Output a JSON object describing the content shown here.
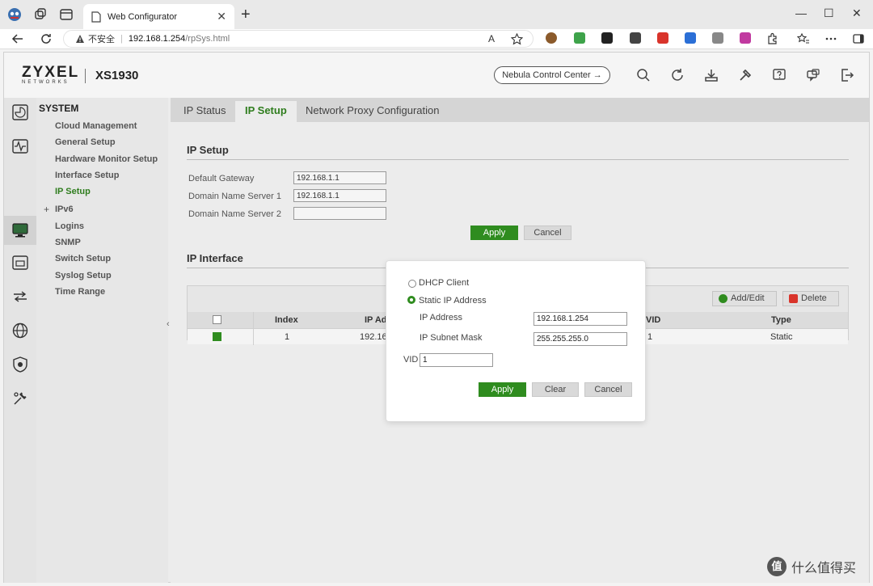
{
  "browser": {
    "tab_title": "Web Configurator",
    "tab_close": "✕",
    "new_tab": "+",
    "url_warning": "不安全",
    "url_host": "192.168.1.254",
    "url_path": "/rpSys.html",
    "read_aloud": "A",
    "win_min": "—",
    "win_max": "☐",
    "win_close": "✕"
  },
  "app": {
    "brand": "ZYXEL",
    "brand_sub": "NETWORKS",
    "model": "XS1930",
    "nebula_button": "Nebula Control Center →"
  },
  "sidemenu": {
    "heading": "SYSTEM",
    "items": [
      {
        "label": "Cloud Management"
      },
      {
        "label": "General Setup"
      },
      {
        "label": "Hardware Monitor Setup"
      },
      {
        "label": "Interface Setup"
      },
      {
        "label": "IP Setup"
      },
      {
        "label": "IPv6"
      },
      {
        "label": "Logins"
      },
      {
        "label": "SNMP"
      },
      {
        "label": "Switch Setup"
      },
      {
        "label": "Syslog Setup"
      },
      {
        "label": "Time Range"
      }
    ],
    "expand_symbol": "+",
    "collapse_symbol": "‹"
  },
  "tabs": [
    {
      "label": "IP Status"
    },
    {
      "label": "IP Setup"
    },
    {
      "label": "Network Proxy Configuration"
    }
  ],
  "ip_setup": {
    "title": "IP Setup",
    "default_gateway_label": "Default Gateway",
    "default_gateway_value": "192.168.1.1",
    "dns1_label": "Domain Name Server 1",
    "dns1_value": "192.168.1.1",
    "dns2_label": "Domain Name Server 2",
    "dns2_value": "",
    "apply": "Apply",
    "cancel": "Cancel"
  },
  "ip_interface": {
    "title": "IP Interface",
    "add_edit": "Add/Edit",
    "delete": "Delete",
    "columns": [
      "Index",
      "IP Add",
      "VID",
      "Type"
    ],
    "rows": [
      {
        "index": "1",
        "ip": "192.168",
        "vid": "1",
        "type": "Static"
      }
    ]
  },
  "modal": {
    "dhcp_label": "DHCP Client",
    "static_label": "Static IP Address",
    "ip_label": "IP Address",
    "ip_value": "192.168.1.254",
    "mask_label": "IP Subnet Mask",
    "mask_value": "255.255.255.0",
    "vid_label": "VID",
    "vid_value": "1",
    "apply": "Apply",
    "clear": "Clear",
    "cancel": "Cancel"
  },
  "watermark": {
    "badge": "值",
    "text": "什么值得买"
  },
  "colors": {
    "accent": "#2f8c1f",
    "active_text": "#2f7d1e"
  }
}
